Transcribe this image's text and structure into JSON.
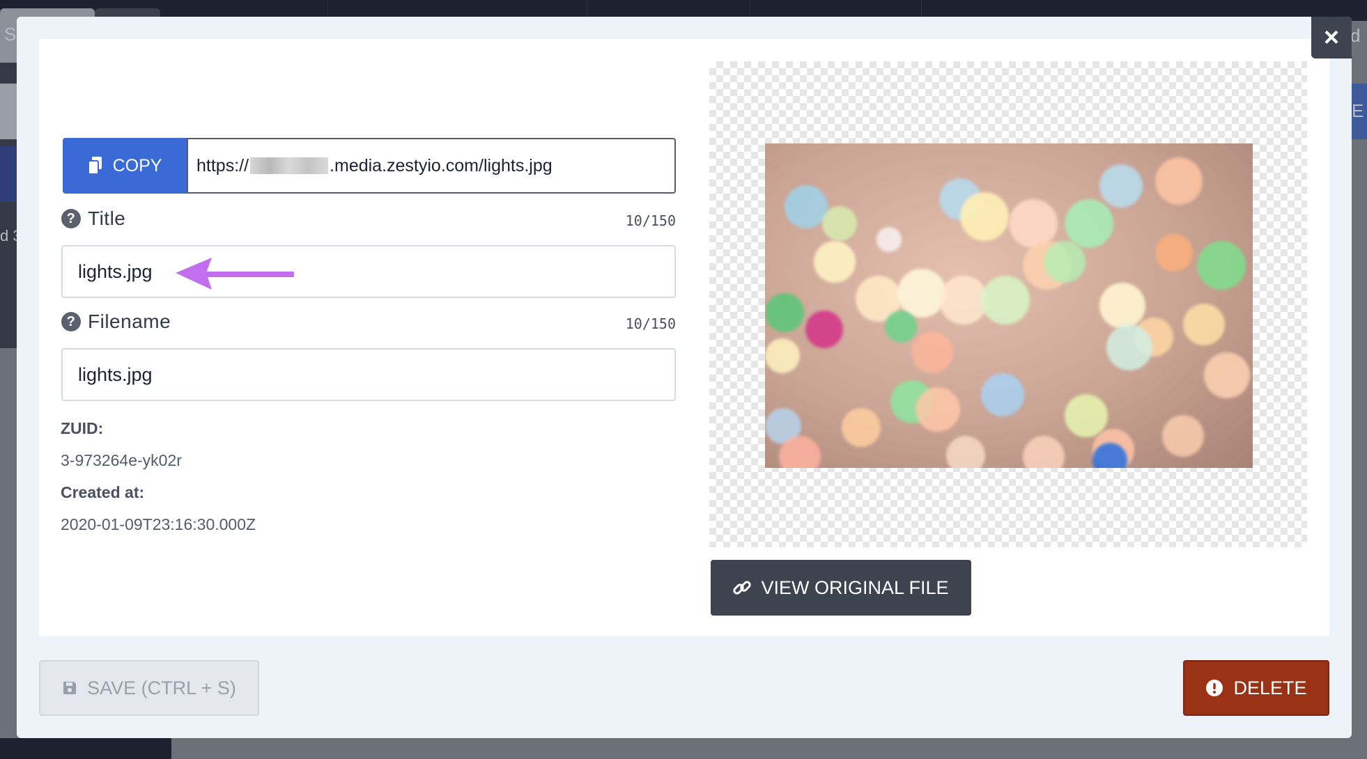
{
  "background": {
    "fragments": [
      "S",
      "d",
      "d 3",
      "E"
    ]
  },
  "modal": {
    "close_label": "×",
    "url_row": {
      "copy_label": "COPY",
      "url_prefix": "https://",
      "url_suffix": ".media.zestyio.com/lights.jpg"
    },
    "title_field": {
      "label": "Title",
      "counter": "10/150",
      "value": "lights.jpg"
    },
    "filename_field": {
      "label": "Filename",
      "counter": "10/150",
      "value": "lights.jpg"
    },
    "meta": {
      "zuid_label": "ZUID:",
      "zuid_value": "3-973264e-yk02r",
      "created_label": "Created at:",
      "created_value": "2020-01-09T23:16:30.000Z"
    },
    "view_original_label": "VIEW ORIGINAL FILE",
    "save_label": "SAVE (CTRL + S)",
    "delete_label": "DELETE",
    "colors": {
      "primary": "#3a6ad6",
      "dark_button": "#3e4350",
      "danger": "#9a3316",
      "annotation_arrow": "#c26ef0"
    }
  }
}
